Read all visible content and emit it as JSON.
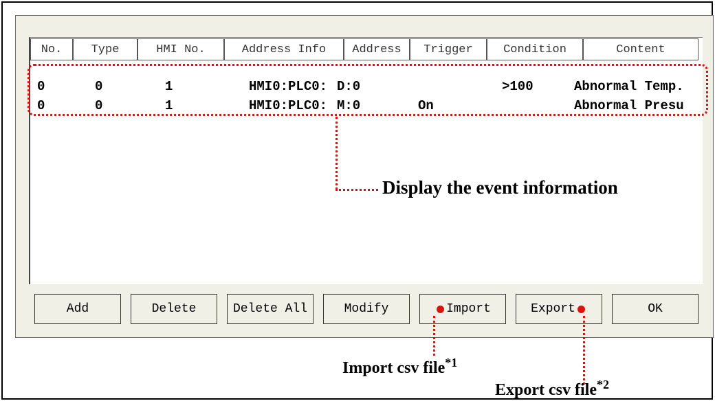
{
  "table": {
    "headers": [
      "No.",
      "Type",
      "HMI No.",
      "Address Info",
      "Address",
      "Trigger",
      "Condition",
      "Content"
    ],
    "rows": [
      [
        "0",
        "0",
        "1",
        "HMI0:PLC0:",
        "D:0",
        "",
        ">100",
        "Abnormal Temp."
      ],
      [
        "0",
        "0",
        "1",
        "HMI0:PLC0:",
        "M:0",
        "On",
        "",
        "Abnormal Presu"
      ]
    ]
  },
  "buttons": {
    "add": "Add",
    "delete": "Delete",
    "delete_all": "Delete All",
    "modify": "Modify",
    "import": "Import",
    "export": "Export",
    "ok": "OK"
  },
  "annotations": {
    "event_info": "Display the event information",
    "import_csv": "Import csv file",
    "import_mark": "*1",
    "export_csv": "Export csv file",
    "export_mark": "*2"
  },
  "colors": {
    "annotation": "#e01010",
    "panel": "#f0f0e6"
  },
  "icons": [
    "red-dot-marker-icon"
  ]
}
